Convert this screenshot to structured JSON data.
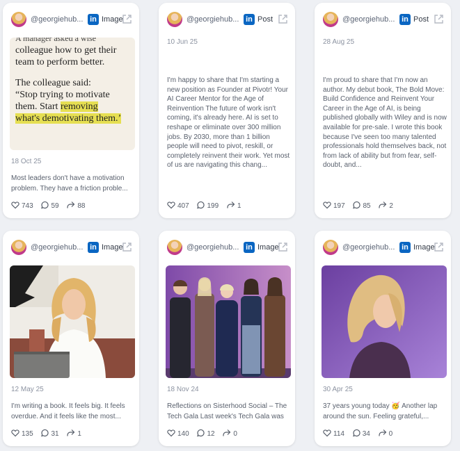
{
  "cards": [
    {
      "handle": "@georgiehub...",
      "platform_icon": "linkedin-icon",
      "type": "Image",
      "date": "18 Oct 25",
      "text": "Most leaders don't have a motivation problem. They have a friction proble...",
      "likes": "743",
      "comments": "59",
      "reposts": "88",
      "image_text": {
        "line0": "A manager asked a wise",
        "line1": "colleague how to get their",
        "line2": "team to perform better.",
        "line3": "The colleague said:",
        "line4a": "“Stop trying to motivate",
        "line5a": "them. Start ",
        "line5b": "removing",
        "line6": "what's demotivating them.’"
      }
    },
    {
      "handle": "@georgiehub...",
      "platform_icon": "linkedin-icon",
      "type": "Post",
      "date": "10 Jun 25",
      "text": "I'm happy to share that I'm starting a new position as Founder at Pivotr! Your AI Career Mentor for the Age of Reinvention The future of work isn't coming, it's already here. AI is set to reshape or eliminate over 300 million jobs. By 2030, more than 1 billion people will need to pivot, reskill, or completely reinvent their work. Yet most of us are navigating this chang...",
      "likes": "407",
      "comments": "199",
      "reposts": "1"
    },
    {
      "handle": "@georgiehub...",
      "platform_icon": "linkedin-icon",
      "type": "Post",
      "date": "28 Aug 25",
      "text": "I'm proud to share that I'm now an author. My debut book, The Bold Move: Build Confidence and Reinvent Your Career in the Age of AI, is being published globally with Wiley and is now available for pre-sale. I wrote this book because I've seen too many talented professionals hold themselves back, not from lack of ability but from fear, self-doubt, and...",
      "likes": "197",
      "comments": "85",
      "reposts": "2"
    },
    {
      "handle": "@georgiehub...",
      "platform_icon": "linkedin-icon",
      "type": "Image",
      "date": "12 May 25",
      "text": "I'm writing a book. It feels big. It feels overdue. And it feels like the most...",
      "likes": "135",
      "comments": "31",
      "reposts": "1"
    },
    {
      "handle": "@georgiehub...",
      "platform_icon": "linkedin-icon",
      "type": "Image",
      "date": "18 Nov 24",
      "text": "Reflections on Sisterhood Social – The Tech Gala Last week's Tech Gala was ...",
      "likes": "140",
      "comments": "12",
      "reposts": "0"
    },
    {
      "handle": "@georgiehub...",
      "platform_icon": "linkedin-icon",
      "type": "Image",
      "date": "30 Apr 25",
      "text": "37 years young today 🥳 Another lap around the sun. Feeling grateful,...",
      "likes": "114",
      "comments": "34",
      "reposts": "0"
    }
  ],
  "colors": {
    "background": "#eef0f4",
    "card": "#ffffff",
    "linkedin": "#0a66c2",
    "muted_text": "#8c93a1",
    "body_text": "#59606d",
    "highlight": "#e6df52"
  }
}
